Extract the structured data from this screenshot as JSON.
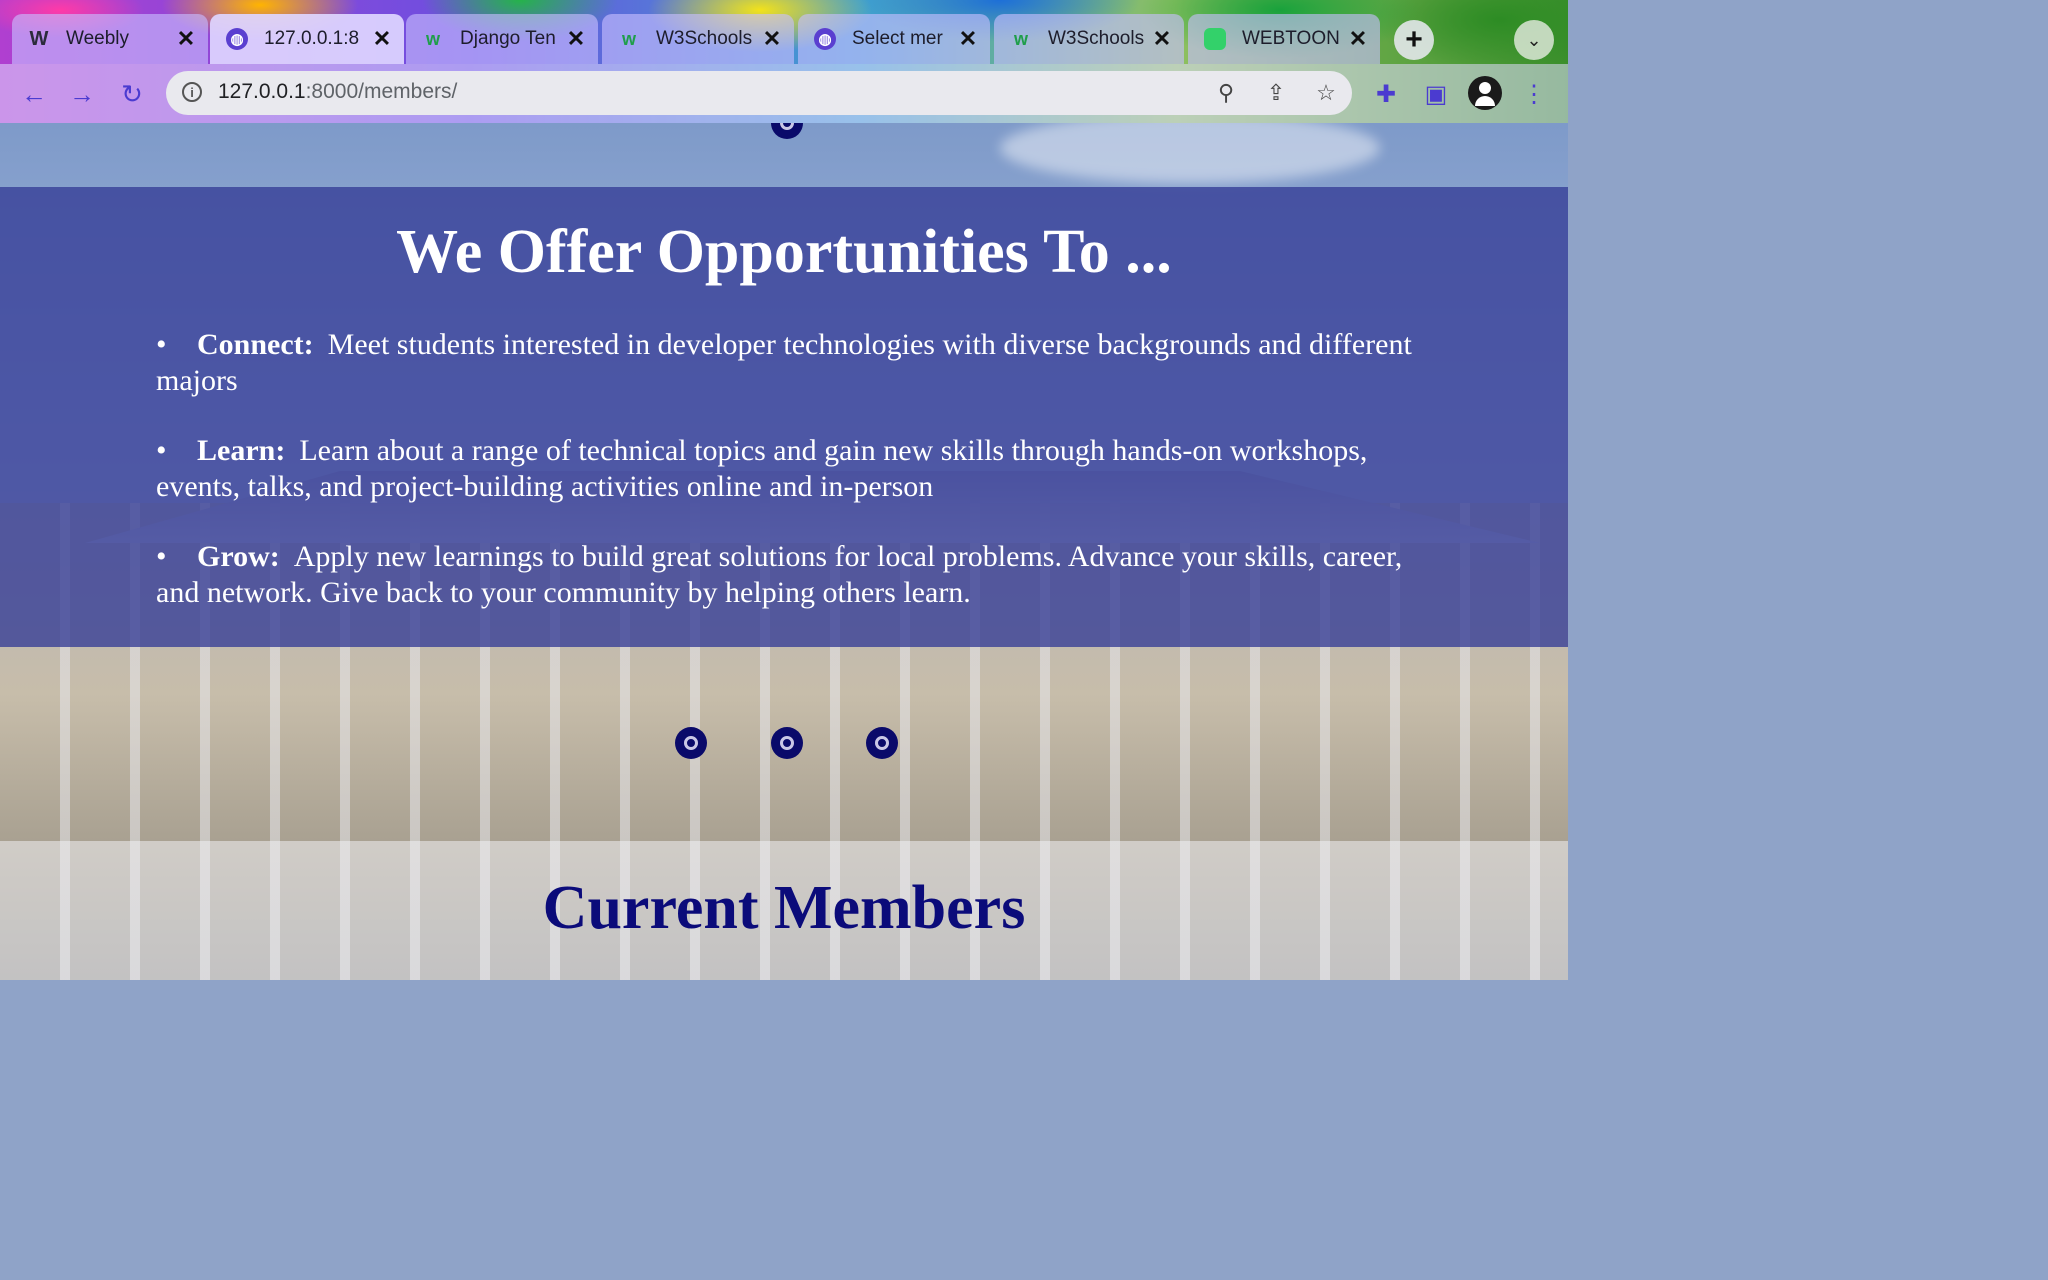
{
  "browser": {
    "tabs": [
      {
        "title": "Weebly",
        "icon": "weebly-icon",
        "active": false
      },
      {
        "title": "127.0.0.1:8",
        "icon": "globe-icon",
        "active": true
      },
      {
        "title": "Django Ten",
        "icon": "w3schools-icon",
        "active": false
      },
      {
        "title": "W3Schools",
        "icon": "w3schools-icon",
        "active": false
      },
      {
        "title": "Select mer",
        "icon": "globe-icon",
        "active": false
      },
      {
        "title": "W3Schools",
        "icon": "w3schools-icon",
        "active": false
      },
      {
        "title": "WEBTOON",
        "icon": "webtoon-icon",
        "active": false
      }
    ],
    "close_glyph": "✕",
    "url_host": "127.0.0.1",
    "url_rest": ":8000/members/"
  },
  "offer": {
    "heading": "We Offer Opportunities To ...",
    "items": [
      {
        "label": "Connect:",
        "text": "Meet students interested in developer technologies with diverse backgrounds and different majors"
      },
      {
        "label": "Learn:",
        "text": "Learn about a range of technical topics and gain new skills through hands-on workshops, events, talks, and project-building activities online and in-person"
      },
      {
        "label": "Grow:",
        "text": "Apply new learnings to build great solutions for local problems. Advance your skills, career, and network. Give back to your community by helping others learn."
      }
    ]
  },
  "members": {
    "heading": "Current Members"
  },
  "colors": {
    "offer_band": "#343c96",
    "members_heading": "#0b0b7a",
    "carousel_dot": "#0a0a6a"
  }
}
